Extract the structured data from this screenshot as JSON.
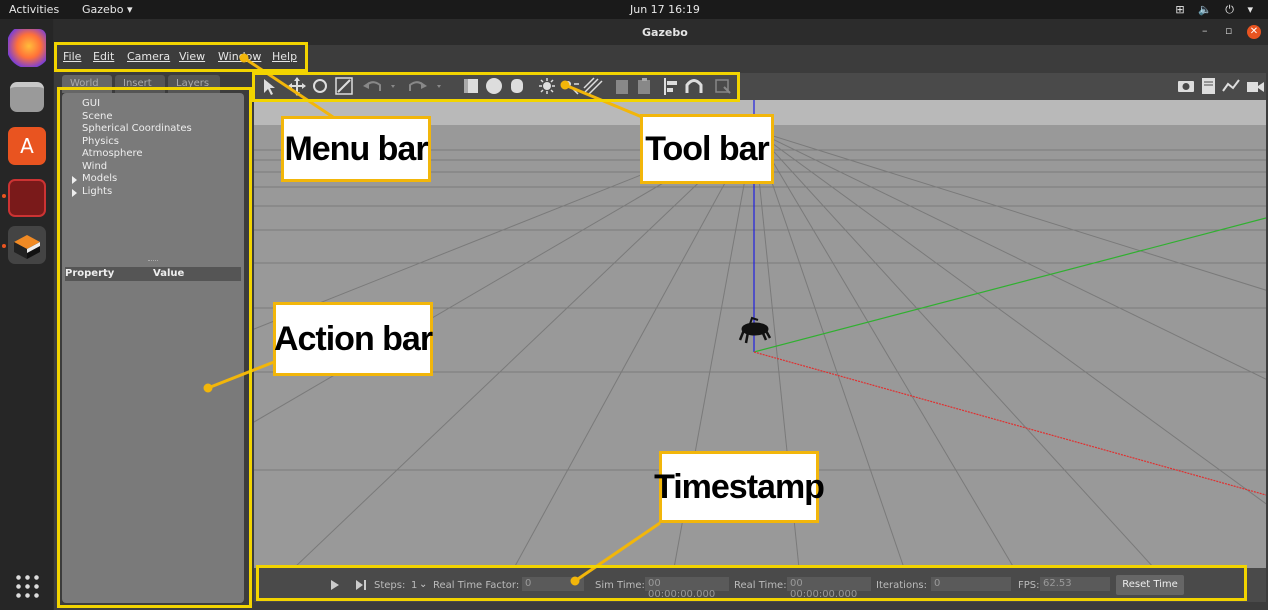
{
  "topbar": {
    "activities": "Activities",
    "app_menu": "Gazebo ▾",
    "datetime": "Jun 17  16:19",
    "tray": "⊞ 🔈 ⏻ ▾"
  },
  "dock": {
    "items": [
      "firefox-icon",
      "files-icon",
      "software-icon",
      "terminal-icon",
      "gazebo-icon"
    ]
  },
  "window": {
    "title": "Gazebo",
    "controls": {
      "minimize": "–",
      "restore": "▫",
      "close": "✕"
    }
  },
  "menubar": {
    "items": [
      "File",
      "Edit",
      "Camera",
      "View",
      "Window",
      "Help"
    ]
  },
  "toolbar": {
    "tools": [
      "select-arrow-icon",
      "translate-icon",
      "rotate-icon",
      "scale-icon",
      "undo-icon",
      "redo-icon",
      "box-icon",
      "sphere-icon",
      "cylinder-icon",
      "point-light-icon",
      "spot-light-icon",
      "directional-light-icon",
      "copy-icon",
      "paste-icon",
      "align-icon",
      "snap-icon",
      "change-view-icon"
    ],
    "right_tools": [
      "screenshot-icon",
      "log-icon",
      "plot-icon",
      "video-icon"
    ]
  },
  "left_panel": {
    "tabs": [
      "World",
      "Insert",
      "Layers"
    ],
    "tree": [
      "GUI",
      "Scene",
      "Spherical Coordinates",
      "Physics",
      "Atmosphere",
      "Wind",
      "Models",
      "Lights"
    ],
    "property_header": "Property",
    "value_header": "Value"
  },
  "bottombar": {
    "steps_label": "Steps:",
    "steps_value": "1",
    "rtf_label": "Real Time Factor:",
    "rtf_value": "0",
    "sim_time_label": "Sim Time:",
    "sim_time_value": "00 00:00:00.000",
    "real_time_label": "Real Time:",
    "real_time_value": "00 00:00:00.000",
    "iterations_label": "Iterations:",
    "iterations_value": "0",
    "fps_label": "FPS:",
    "fps_value": "62.53",
    "reset_label": "Reset Time"
  },
  "annotations": {
    "menu_bar": "Menu bar",
    "tool_bar": "Tool bar",
    "action_bar": "Action bar",
    "timestamp": "Timestamp"
  },
  "colors": {
    "accent": "#e95420",
    "highlight": "#f2d400",
    "callout_border": "#f2b60a",
    "axis_x": "#e03030",
    "axis_y": "#30b030",
    "axis_z": "#2020e0"
  }
}
